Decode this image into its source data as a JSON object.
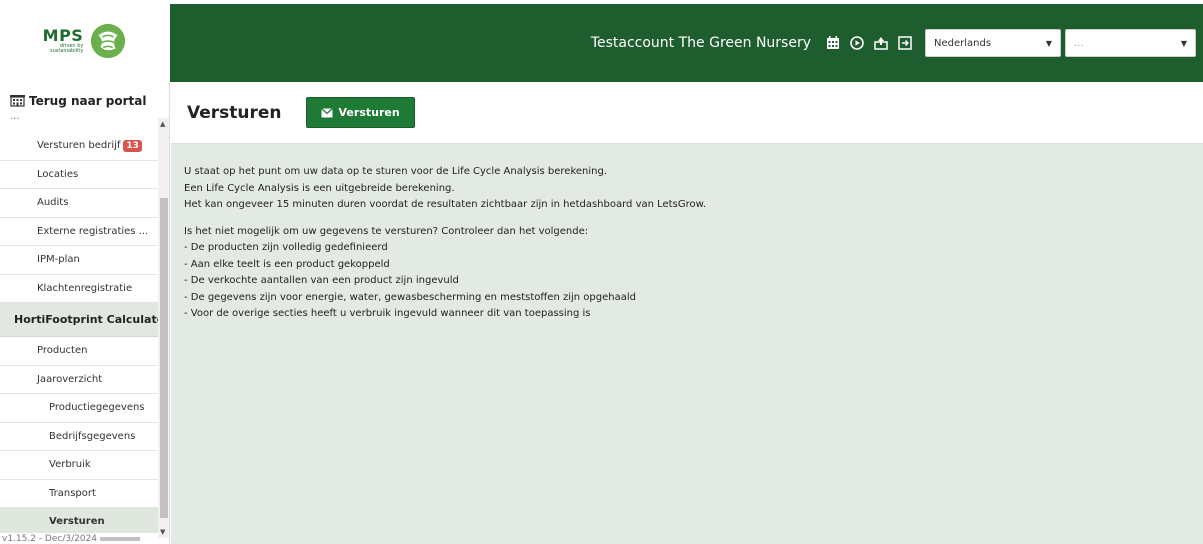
{
  "logo": {
    "brand": "MPS",
    "tagline_1": "driven by",
    "tagline_2": "sustainability"
  },
  "header": {
    "account": "Testaccount The Green Nursery",
    "icons": [
      "calendar-icon",
      "play-icon",
      "upload-icon",
      "logout-icon"
    ],
    "language": "Nederlands",
    "secondary_select": "..."
  },
  "sidebar": {
    "back_label": "Terug naar portal",
    "partial_label": "...",
    "items_top": [
      {
        "label": "Versturen bedrijf",
        "badge": "13"
      },
      {
        "label": "Locaties"
      },
      {
        "label": "Audits"
      },
      {
        "label": "Externe registraties ..."
      },
      {
        "label": "IPM-plan"
      },
      {
        "label": "Klachtenregistratie"
      }
    ],
    "section_title": "HortiFootprint Calculator",
    "items_section": [
      {
        "label": "Producten",
        "level": 1
      },
      {
        "label": "Jaaroverzicht",
        "level": 1
      },
      {
        "label": "Productiegegevens",
        "level": 2
      },
      {
        "label": "Bedrijfsgegevens",
        "level": 2
      },
      {
        "label": "Verbruik",
        "level": 2
      },
      {
        "label": "Transport",
        "level": 2
      },
      {
        "label": "Versturen",
        "level": 2,
        "active": true
      }
    ],
    "version": "v1.15.2 - Dec/3/2024"
  },
  "page": {
    "title": "Versturen",
    "send_button": "Versturen"
  },
  "content": {
    "intro_lines": [
      "U staat op het punt om uw data op te sturen voor de Life Cycle Analysis berekening.",
      "Een Life Cycle Analysis is een uitgebreide berekening.",
      "Het kan ongeveer 15 minuten duren voordat de resultaten zichtbaar zijn in hetdashboard van LetsGrow."
    ],
    "check_lines": [
      "Is het niet mogelijk om uw gegevens te versturen? Controleer dan het volgende:",
      "- De producten zijn volledig gedefinieerd",
      "- Aan elke teelt is een product gekoppeld",
      "- De verkochte aantallen van een product zijn ingevuld",
      "- De gegevens zijn voor energie, water, gewasbescherming en meststoffen zijn opgehaald",
      "- Voor de overige secties heeft u verbruik ingevuld wanneer dit van toepassing is"
    ]
  },
  "colors": {
    "header_green": "#1e5e2e",
    "button_green": "#1e7a34",
    "content_bg": "#e3e9e3",
    "badge_red": "#d9534f"
  }
}
